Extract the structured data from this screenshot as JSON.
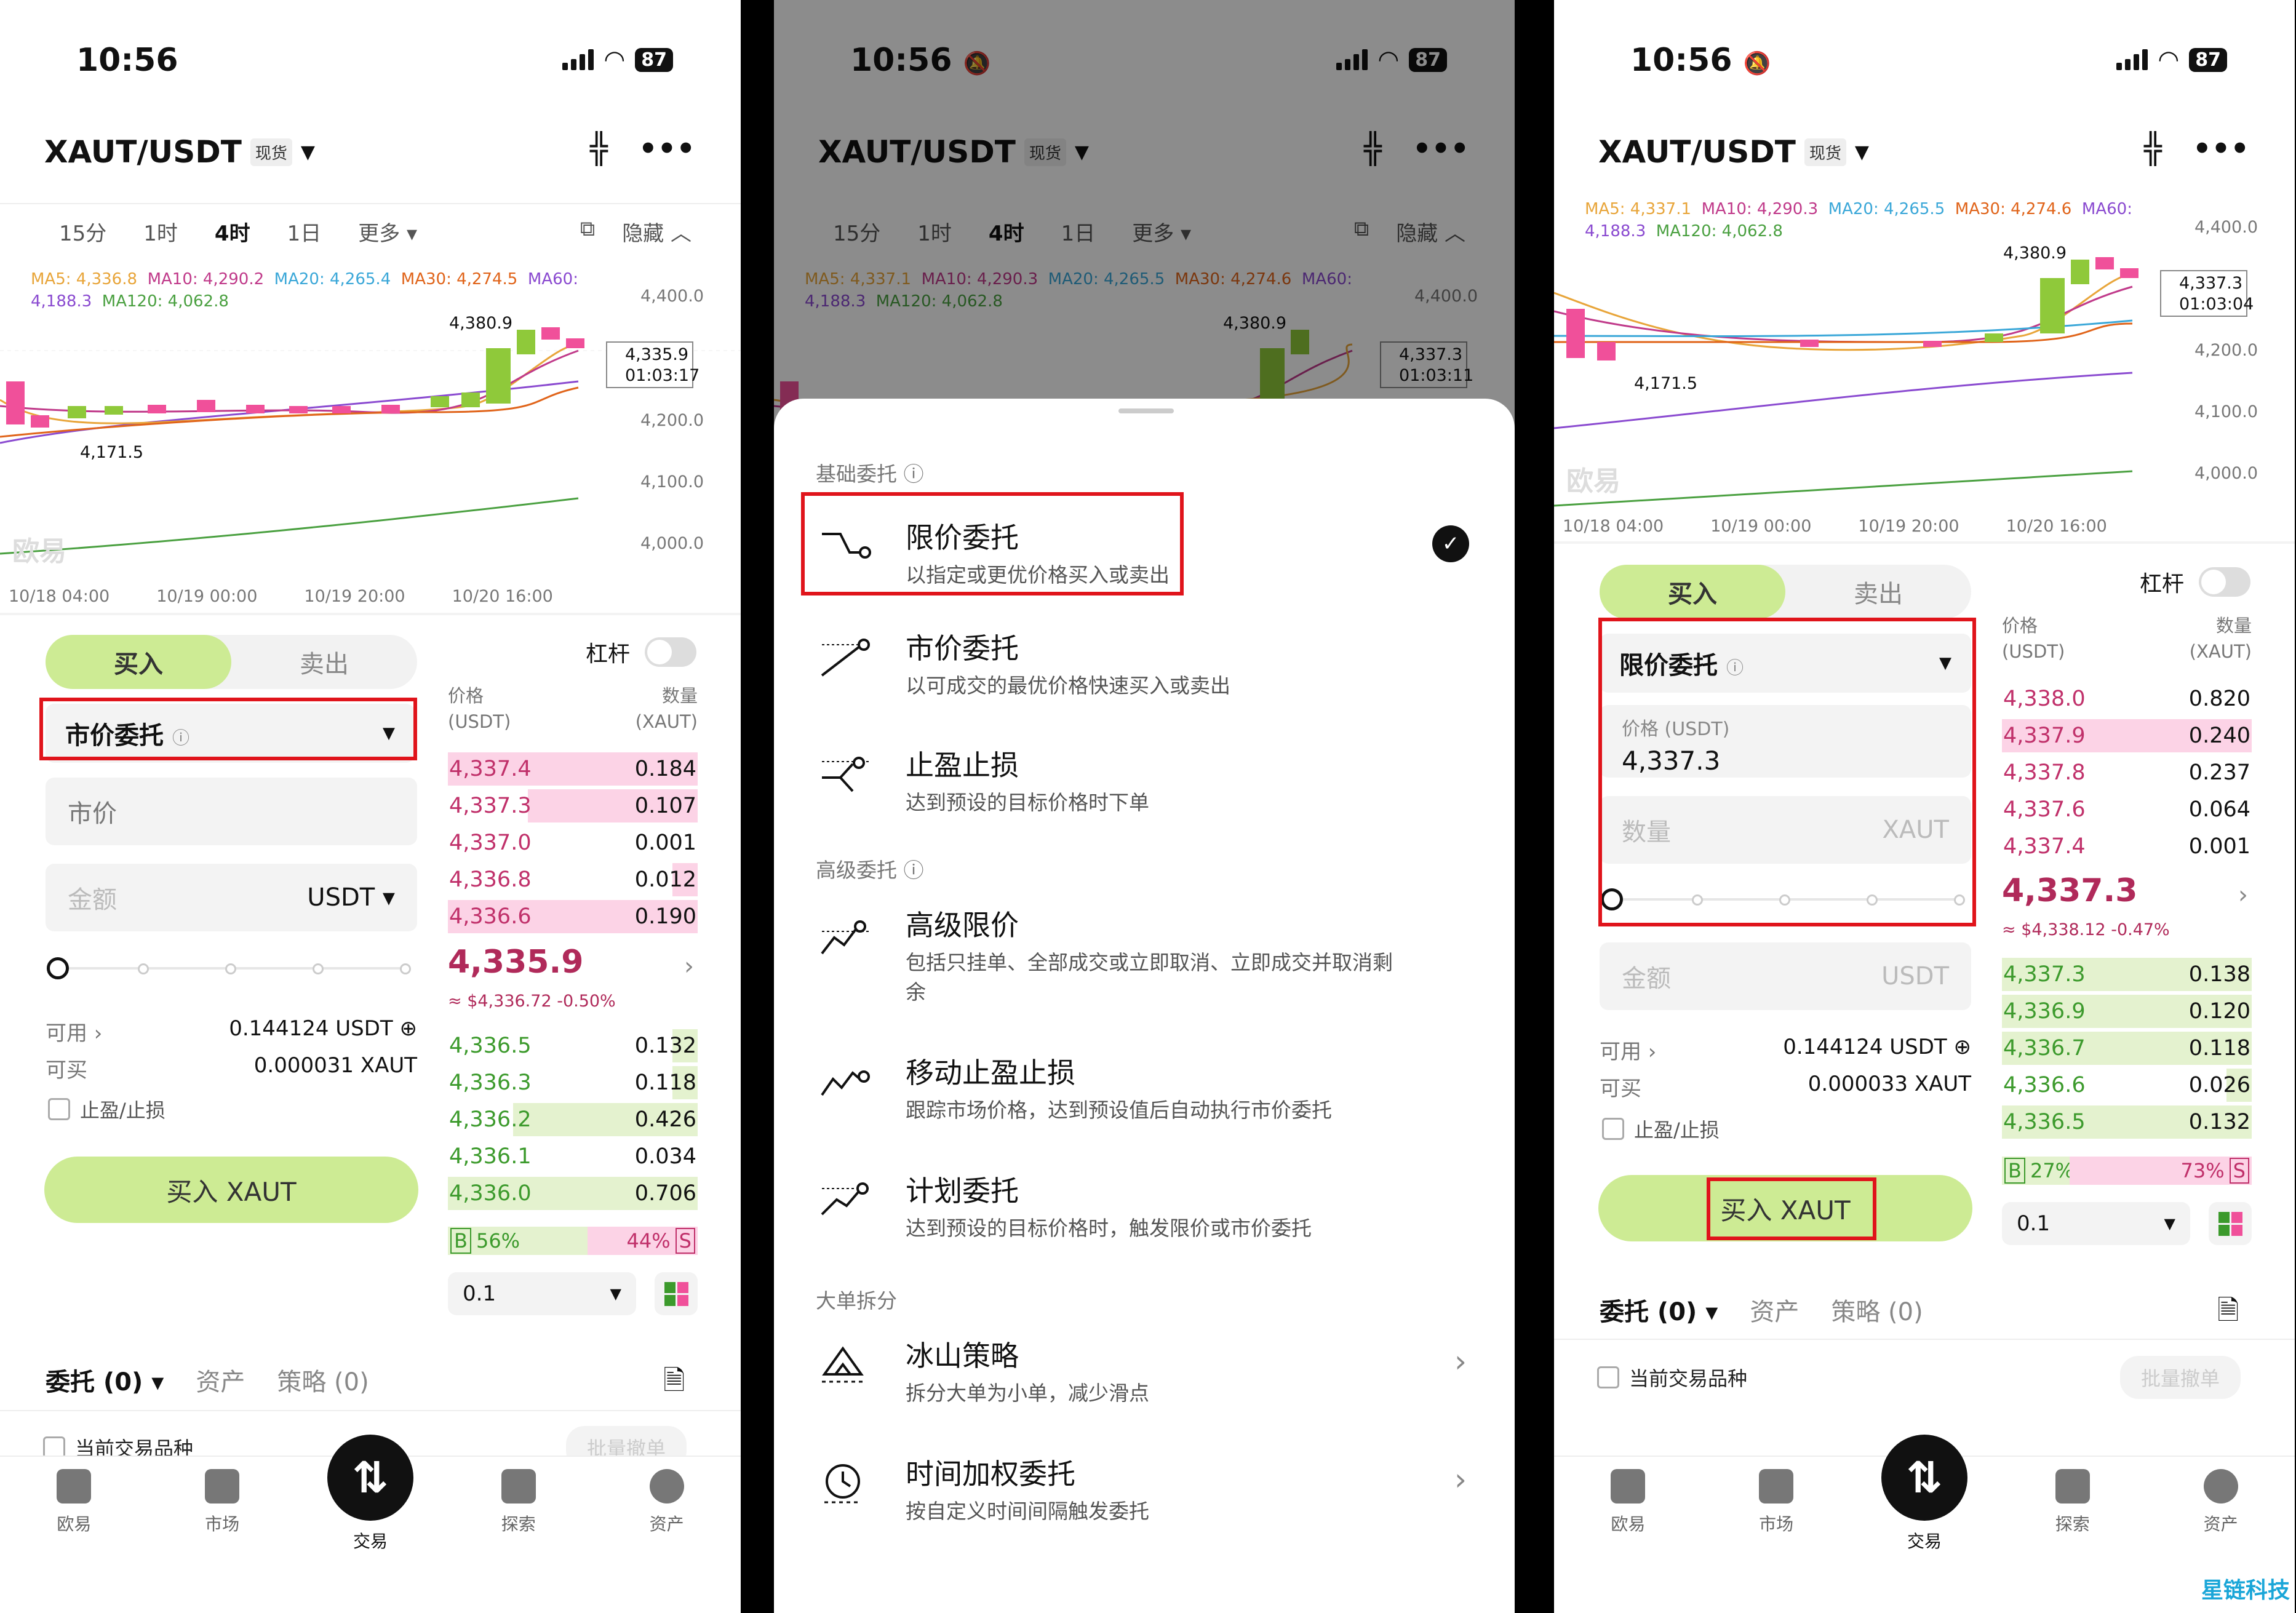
{
  "panels": [
    {
      "time": "10:56",
      "battery": "87",
      "pair": "XAUT/USDT",
      "tag": "现货",
      "timeframes": [
        "15分",
        "1时",
        "4时",
        "1日",
        "更多 ▾"
      ],
      "hide": "隐藏",
      "ma": [
        "MA5: 4,336.8",
        "MA10: 4,290.2",
        "MA20: 4,265.4",
        "MA30: 4,274.5",
        "MA60:",
        "4,188.3",
        "MA120: 4,062.8"
      ],
      "price_axis": [
        "4,400.0",
        "4,200.0",
        "4,100.0",
        "4,000.0"
      ],
      "last_price_tag": "4,335.9",
      "countdown": "01:03:17",
      "high": "4,380.9",
      "low": "4,171.5",
      "dates": [
        "10/18 04:00",
        "10/19 00:00",
        "10/19 20:00",
        "10/20 16:00"
      ],
      "watermark": "欧易",
      "buy": "买入",
      "sell": "卖出",
      "lever": "杠杆",
      "order_type": "市价委托",
      "price_field": "市价",
      "amount_ph": "金额",
      "amount_unit": "USDT ▾",
      "avail_label": "可用",
      "avail": "0.144124 USDT",
      "buyable_label": "可买",
      "buyable": "0.000031 XAUT",
      "tpsl": "止盈/止损",
      "buy_btn": "买入 XAUT",
      "ob_h1": "价格",
      "ob_h1b": "(USDT)",
      "ob_h2": "数量",
      "ob_h2b": "(XAUT)",
      "asks": [
        [
          "4,337.4",
          "0.184"
        ],
        [
          "4,337.3",
          "0.107"
        ],
        [
          "4,337.0",
          "0.001"
        ],
        [
          "4,336.8",
          "0.012"
        ],
        [
          "4,336.6",
          "0.190"
        ]
      ],
      "mid": "4,335.9",
      "mid_sub": "≈ $4,336.72 -0.50%",
      "bids": [
        [
          "4,336.5",
          "0.132"
        ],
        [
          "4,336.3",
          "0.118"
        ],
        [
          "4,336.2",
          "0.426"
        ],
        [
          "4,336.1",
          "0.034"
        ],
        [
          "4,336.0",
          "0.706"
        ]
      ],
      "b_pct": "56%",
      "s_pct": "44%",
      "tick": "0.1",
      "orders": "委托 (0) ▾",
      "assets": "资产",
      "strat": "策略 (0)",
      "cur_pair": "当前交易品种",
      "batch": "批量撤单",
      "nav": [
        "欧易",
        "市场",
        "交易",
        "探索",
        "资产"
      ]
    },
    {
      "time": "10:56",
      "battery": "87",
      "pair": "XAUT/USDT",
      "tag": "现货",
      "timeframes": [
        "15分",
        "1时",
        "4时",
        "1日",
        "更多 ▾"
      ],
      "hide": "隐藏",
      "ma": [
        "MA5: 4,337.1",
        "MA10: 4,290.3",
        "MA20: 4,265.5",
        "MA30: 4,274.6",
        "MA60:",
        "4,188.3",
        "MA120: 4,062.8"
      ],
      "price_axis": [
        "4,400.0"
      ],
      "last_price_tag": "4,337.3",
      "countdown": "01:03:11",
      "high": "4,380.9",
      "sheet": {
        "sec1": "基础委托 ⓘ",
        "sec2": "高级委托 ⓘ",
        "sec3": "大单拆分",
        "options": [
          {
            "t": "限价委托",
            "d": "以指定或更优价格买入或卖出"
          },
          {
            "t": "市价委托",
            "d": "以可成交的最优价格快速买入或卖出"
          },
          {
            "t": "止盈止损",
            "d": "达到预设的目标价格时下单"
          },
          {
            "t": "高级限价",
            "d": "包括只挂单、全部成交或立即取消、立即成交并取消剩",
            "d2": "余"
          },
          {
            "t": "移动止盈止损",
            "d": "跟踪市场价格，达到预设值后自动执行市价委托"
          },
          {
            "t": "计划委托",
            "d": "达到预设的目标价格时，触发限价或市价委托"
          },
          {
            "t": "冰山策略",
            "d": "拆分大单为小单，减少滑点"
          },
          {
            "t": "时间加权委托",
            "d": "按自定义时间间隔触发委托"
          }
        ]
      }
    },
    {
      "time": "10:56",
      "battery": "87",
      "pair": "XAUT/USDT",
      "tag": "现货",
      "ma": [
        "MA5: 4,337.1",
        "MA10: 4,290.3",
        "MA20: 4,265.5",
        "MA30: 4,274.6",
        "MA60:",
        "4,188.3",
        "MA120: 4,062.8"
      ],
      "price_axis": [
        "4,400.0",
        "4,200.0",
        "4,100.0",
        "4,000.0"
      ],
      "last_price_tag": "4,337.3",
      "countdown": "01:03:04",
      "high": "4,380.9",
      "low": "4,171.5",
      "dates": [
        "10/18 04:00",
        "10/19 00:00",
        "10/19 20:00",
        "10/20 16:00"
      ],
      "watermark": "欧易",
      "buy": "买入",
      "sell": "卖出",
      "lever": "杠杆",
      "order_type": "限价委托",
      "price_label": "价格 (USDT)",
      "price_val": "4,337.3",
      "qty_ph": "数量",
      "qty_unit": "XAUT",
      "amount_ph": "金额",
      "amount_unit": "USDT",
      "avail_label": "可用",
      "avail": "0.144124 USDT",
      "buyable_label": "可买",
      "buyable": "0.000033 XAUT",
      "tpsl": "止盈/止损",
      "buy_btn": "买入 XAUT",
      "ob_h1": "价格",
      "ob_h1b": "(USDT)",
      "ob_h2": "数量",
      "ob_h2b": "(XAUT)",
      "asks": [
        [
          "4,338.0",
          "0.820"
        ],
        [
          "4,337.9",
          "0.240"
        ],
        [
          "4,337.8",
          "0.237"
        ],
        [
          "4,337.6",
          "0.064"
        ],
        [
          "4,337.4",
          "0.001"
        ]
      ],
      "mid": "4,337.3",
      "mid_sub": "≈ $4,338.12 -0.47%",
      "bids": [
        [
          "4,337.3",
          "0.138"
        ],
        [
          "4,336.9",
          "0.120"
        ],
        [
          "4,336.7",
          "0.118"
        ],
        [
          "4,336.6",
          "0.026"
        ],
        [
          "4,336.5",
          "0.132"
        ]
      ],
      "b_pct": "27%",
      "s_pct": "73%",
      "tick": "0.1",
      "orders": "委托 (0) ▾",
      "assets": "资产",
      "strat": "策略 (0)",
      "cur_pair": "当前交易品种",
      "batch": "批量撤单",
      "nav": [
        "欧易",
        "市场",
        "交易",
        "探索",
        "资产"
      ],
      "site": "星链科技"
    }
  ],
  "colors": {
    "buy": "#cdeb94",
    "sell_text": "#c0306a",
    "highlight": "#e0141b"
  }
}
